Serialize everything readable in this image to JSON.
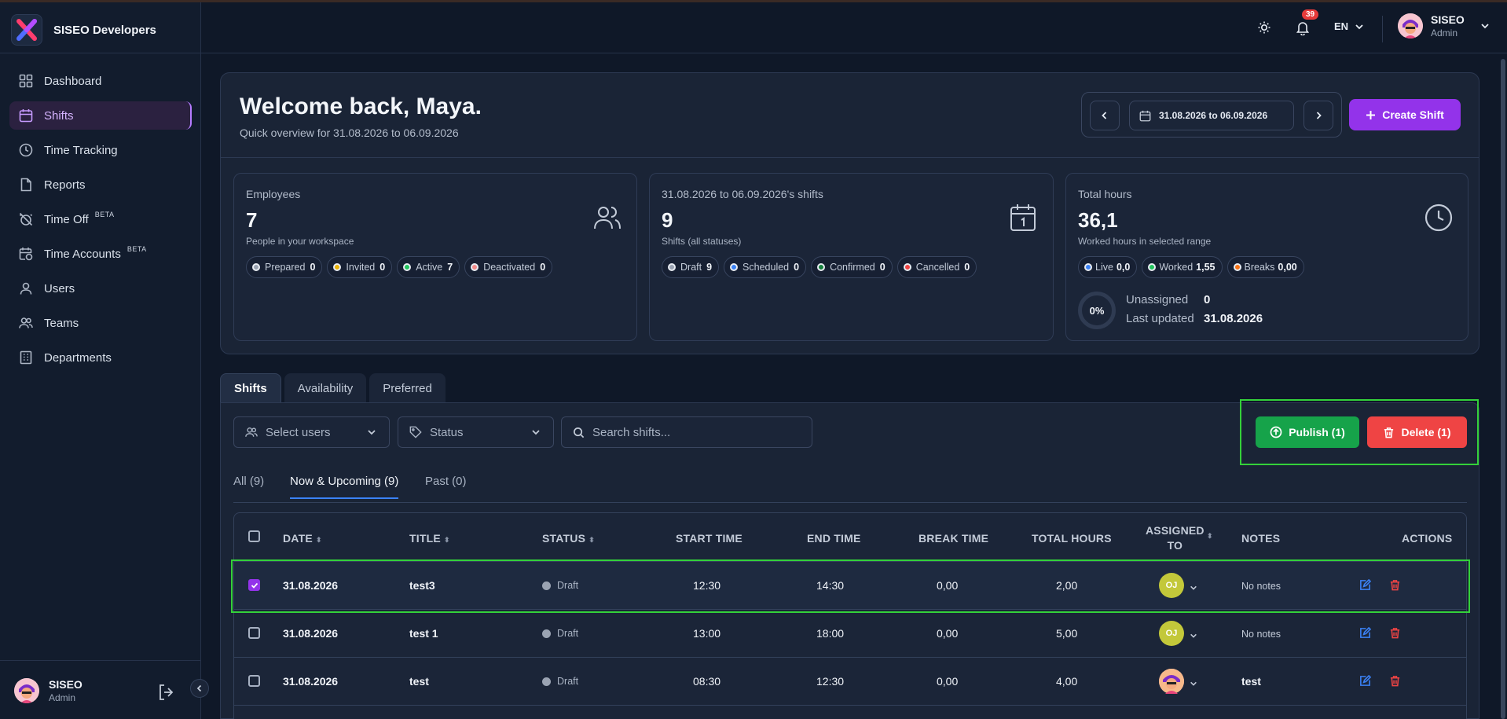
{
  "app": {
    "name": "SISEO Developers"
  },
  "sidebar": {
    "items": [
      {
        "label": "Dashboard",
        "icon": "grid-icon"
      },
      {
        "label": "Shifts",
        "icon": "calendar-icon",
        "active": true
      },
      {
        "label": "Time Tracking",
        "icon": "clock-icon"
      },
      {
        "label": "Reports",
        "icon": "file-icon"
      },
      {
        "label": "Time Off",
        "icon": "no-alarm-icon",
        "badge": "BETA"
      },
      {
        "label": "Time Accounts",
        "icon": "calendar-clock-icon",
        "badge": "BETA"
      },
      {
        "label": "Users",
        "icon": "user-icon"
      },
      {
        "label": "Teams",
        "icon": "users-icon"
      },
      {
        "label": "Departments",
        "icon": "building-icon"
      }
    ],
    "user": {
      "name": "SISEO",
      "role": "Admin"
    }
  },
  "header": {
    "notifications": "39",
    "language": "EN",
    "user": {
      "name": "SISEO",
      "role": "Admin"
    }
  },
  "welcome": {
    "title": "Welcome back, Maya.",
    "subtitle": "Quick overview for 31.08.2026 to 06.09.2026",
    "range": "31.08.2026 to 06.09.2026",
    "create_label": "Create Shift"
  },
  "cards": {
    "employees": {
      "label": "Employees",
      "value": "7",
      "sub": "People in your workspace",
      "chips": [
        {
          "label": "Prepared",
          "count": "0",
          "color": "#9aa3b2"
        },
        {
          "label": "Invited",
          "count": "0",
          "color": "#eab308"
        },
        {
          "label": "Active",
          "count": "7",
          "color": "#22c55e"
        },
        {
          "label": "Deactivated",
          "count": "0",
          "color": "#f28b8b"
        }
      ]
    },
    "shifts": {
      "label": "31.08.2026 to 06.09.2026's shifts",
      "value": "9",
      "sub": "Shifts (all statuses)",
      "chips": [
        {
          "label": "Draft",
          "count": "9",
          "color": "#9aa3b2"
        },
        {
          "label": "Scheduled",
          "count": "0",
          "color": "#3b82f6"
        },
        {
          "label": "Confirmed",
          "count": "0",
          "color": "#15803d"
        },
        {
          "label": "Cancelled",
          "count": "0",
          "color": "#ef4444"
        }
      ]
    },
    "hours": {
      "label": "Total hours",
      "value": "36,1",
      "sub": "Worked hours in selected range",
      "chips": [
        {
          "label": "Live",
          "count": "0,0",
          "color": "#3b82f6"
        },
        {
          "label": "Worked",
          "count": "1,55",
          "color": "#22c55e"
        },
        {
          "label": "Breaks",
          "count": "0,00",
          "color": "#f97316"
        }
      ],
      "gauge": "0%",
      "unassigned_label": "Unassigned",
      "unassigned_value": "0",
      "updated_label": "Last updated",
      "updated_value": "31.08.2026"
    }
  },
  "tabs": [
    "Shifts",
    "Availability",
    "Preferred"
  ],
  "filters": {
    "users": "Select users",
    "status": "Status",
    "search_placeholder": "Search shifts..."
  },
  "bulk": {
    "publish": "Publish (1)",
    "delete": "Delete (1)"
  },
  "subtabs": [
    "All (9)",
    "Now & Upcoming (9)",
    "Past (0)"
  ],
  "table": {
    "headers": {
      "date": "DATE",
      "title": "TITLE",
      "status": "STATUS",
      "start": "START TIME",
      "end": "END TIME",
      "break": "BREAK TIME",
      "total": "TOTAL HOURS",
      "assigned1": "ASSIGNED",
      "assigned2": "TO",
      "notes": "NOTES",
      "actions": "ACTIONS"
    },
    "rows": [
      {
        "date": "31.08.2026",
        "title": "test3",
        "status": "Draft",
        "start": "12:30",
        "end": "14:30",
        "break": "0,00",
        "total": "2,00",
        "assignee": "OJ",
        "notes": "No notes"
      },
      {
        "date": "31.08.2026",
        "title": "test 1",
        "status": "Draft",
        "start": "13:00",
        "end": "18:00",
        "break": "0,00",
        "total": "5,00",
        "assignee": "OJ",
        "notes": "No notes"
      },
      {
        "date": "31.08.2026",
        "title": "test",
        "status": "Draft",
        "start": "08:30",
        "end": "12:30",
        "break": "0,00",
        "total": "4,00",
        "assignee": "",
        "notes": "test"
      }
    ]
  }
}
